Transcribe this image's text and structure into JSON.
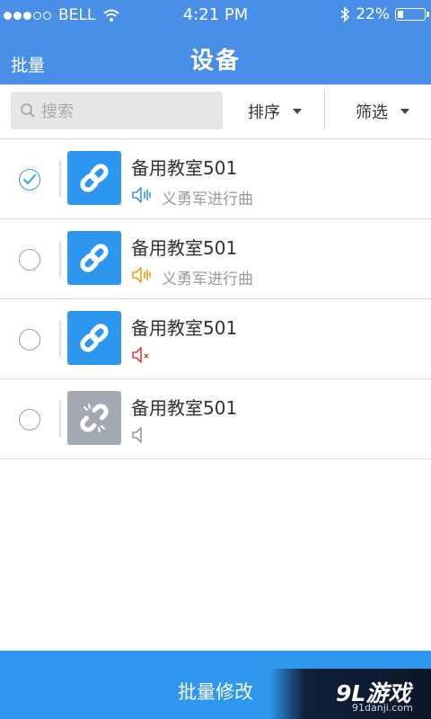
{
  "status_bar": {
    "carrier": "BELL",
    "time": "4:21 PM",
    "battery": "22%",
    "battery_level": 0.22,
    "signal_bars_filled": 3,
    "signal_bars_total": 5
  },
  "header": {
    "left_action": "批量",
    "title": "设备"
  },
  "toolbar": {
    "search_placeholder": "搜索",
    "sort_label": "排序",
    "filter_label": "筛选"
  },
  "devices": [
    {
      "name": "备用教室501",
      "selected": true,
      "online": true,
      "volume_state": "playing",
      "volume_color": "#3a98e8",
      "track": "义勇军进行曲"
    },
    {
      "name": "备用教室501",
      "selected": false,
      "online": true,
      "volume_state": "playing",
      "volume_color": "#f2a019",
      "track": "义勇军进行曲"
    },
    {
      "name": "备用教室501",
      "selected": false,
      "online": true,
      "volume_state": "muted",
      "volume_color": "#e04040",
      "track": ""
    },
    {
      "name": "备用教室501",
      "selected": false,
      "online": false,
      "volume_state": "idle",
      "volume_color": "#9a9a9a",
      "track": ""
    }
  ],
  "bottom": {
    "batch_edit_label": "批量修改"
  },
  "watermark": {
    "logo": "9L游戏",
    "site": "91danji.com"
  },
  "colors": {
    "header": "#4a8fe7",
    "accent": "#2f97f0",
    "thumb_online": "#2d96ef",
    "thumb_offline": "#a3a9b0"
  }
}
